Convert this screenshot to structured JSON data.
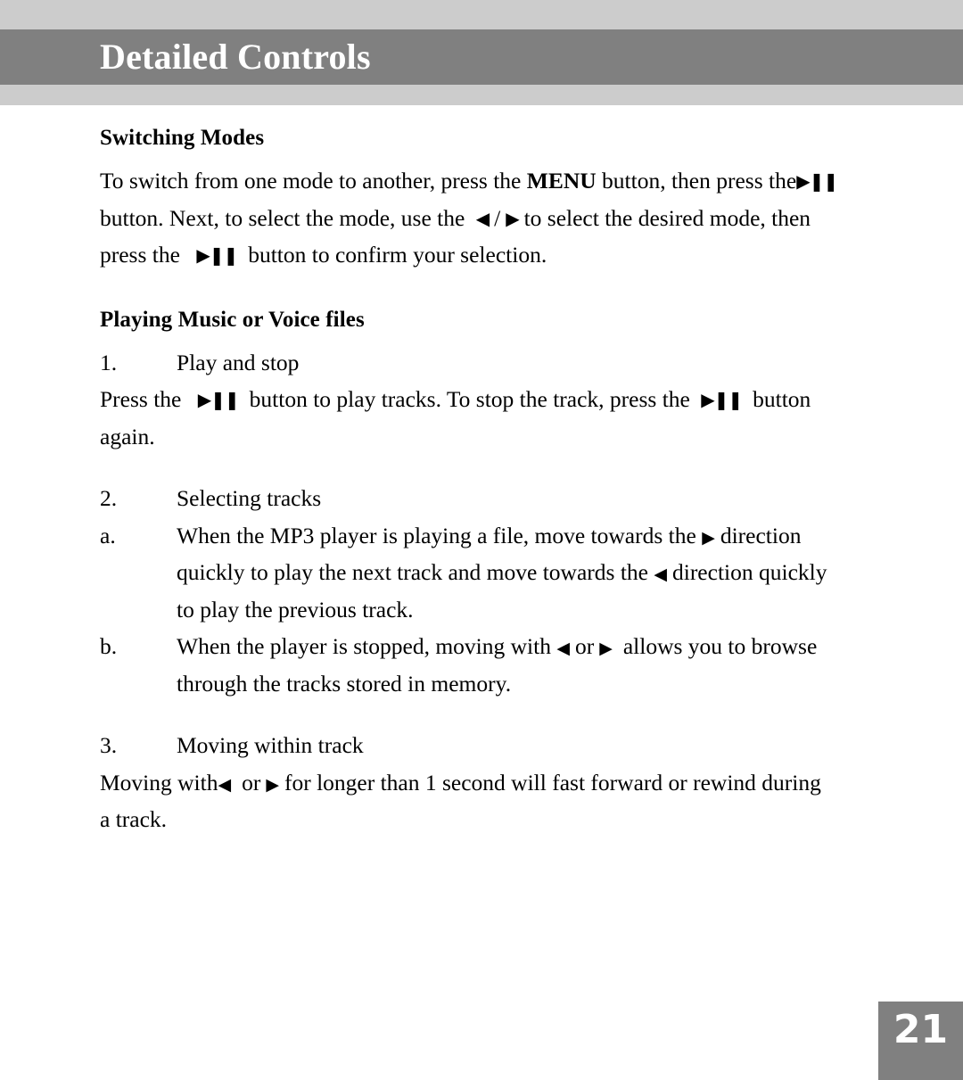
{
  "page": {
    "header": {
      "title": "Detailed Controls",
      "band_color": "#cccccc",
      "bar_color": "#808080",
      "title_color": "#ffffff"
    },
    "page_number": "21",
    "page_number_box_color": "#808080"
  },
  "glyphs": {
    "play_pause": "▶❚❚",
    "play": "▶",
    "prev": "◀",
    "next": "▶"
  },
  "sections": [
    {
      "id": "switching-modes",
      "heading": "Switching Modes",
      "paragraph": {
        "p1_a": "To switch from one mode to another, press the ",
        "p1_menu": "MENU",
        "p1_b": " button, then press the",
        "p2_a": "button. Next, to select the mode, use the ",
        "p2_slash": "/",
        "p2_b": "to select the desired mode, then",
        "p3_a": "press the ",
        "p3_b": "button to confirm your selection."
      }
    },
    {
      "id": "playing-music-or-voice-files",
      "heading": "Playing Music or Voice files",
      "items": [
        {
          "marker": "1.",
          "title": "Play and stop",
          "body_a": "Press the ",
          "body_b": "button to play tracks. To stop the track, press the ",
          "body_c": "button",
          "body_d": "again."
        },
        {
          "marker": "2.",
          "title": "Selecting tracks",
          "sub": [
            {
              "marker": "a.",
              "text_a": "When the MP3 player is playing a file, move towards the ",
              "text_b": "direction",
              "text_c": "quickly to play the next track and move towards the ",
              "text_d": "direction quickly",
              "text_e": "to play the previous track."
            },
            {
              "marker": "b.",
              "text_a": "When the player is stopped, moving with ",
              "text_or": "or",
              "text_b": "allows you to browse",
              "text_c": "through the tracks stored in memory."
            }
          ]
        },
        {
          "marker": "3.",
          "title": "Moving within track",
          "body_a": "Moving with",
          "body_or": "or",
          "body_b": "for longer than 1 second will fast forward or rewind during",
          "body_c": "a track."
        }
      ]
    }
  ]
}
